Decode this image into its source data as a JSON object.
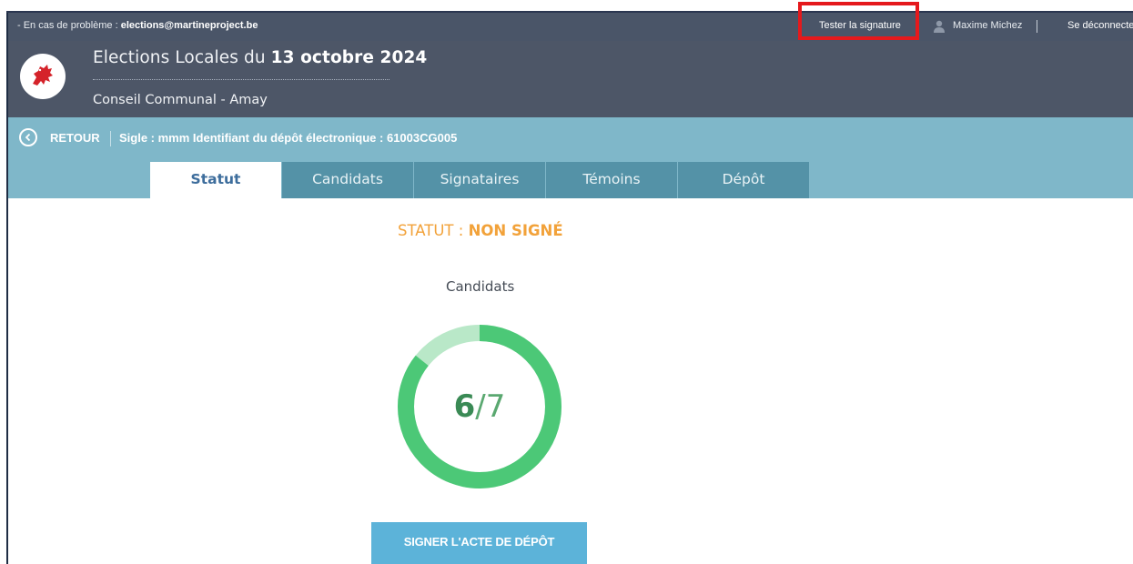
{
  "topbar": {
    "contact_prefix": "- En cas de problème : ",
    "contact_email": "elections@martineproject.be",
    "test_signature": "Tester la signature",
    "user_name": "Maxime Michez",
    "logout": "Se déconnecter"
  },
  "header": {
    "title_prefix": "Elections Locales du ",
    "title_date": "13 octobre 2024",
    "subtitle": "Conseil Communal - Amay"
  },
  "infobar": {
    "back": "RETOUR",
    "sigle": "Sigle : mmm  Identifiant du dépôt électronique : 61003CG005"
  },
  "tabs": [
    {
      "label": "Statut",
      "active": true
    },
    {
      "label": "Candidats",
      "active": false
    },
    {
      "label": "Signataires",
      "active": false
    },
    {
      "label": "Témoins",
      "active": false
    },
    {
      "label": "Dépôt",
      "active": false
    }
  ],
  "status": {
    "prefix": "STATUT : ",
    "value": "NON SIGNÉ"
  },
  "candidates": {
    "label": "Candidats",
    "count": "6",
    "separator": "/",
    "total": "7",
    "fraction": 0.857
  },
  "sign_button": "SIGNER L'ACTE DE DÉPÔT",
  "colors": {
    "topbar": "#4a5568",
    "header": "#4d5667",
    "infobar": "#7fb7c9",
    "tab": "#5492a7",
    "status": "#f2a23a",
    "donut_done": "#4cc877",
    "donut_remaining": "#b9e8c8",
    "button": "#5cb3d9",
    "highlight": "#e5191c"
  }
}
